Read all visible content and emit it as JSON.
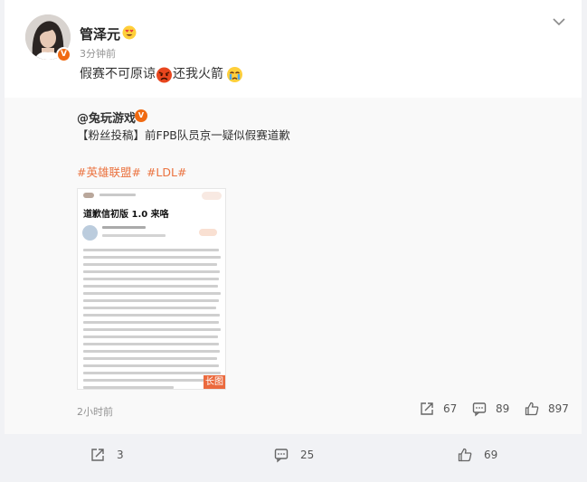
{
  "post": {
    "username": "管泽元",
    "time": "3分钟前",
    "text_part1": "假赛不可原谅",
    "text_part2": "还我火箭",
    "name_emoji": "heart-eyes-emoji",
    "emoji1": "angry-emoji",
    "emoji2": "crying-emoji",
    "avatar_badge": "V"
  },
  "repost": {
    "author": "@兔玩游戏",
    "badge": "V",
    "text": "【粉丝投稿】前FPB队员京一疑似假赛道歉",
    "tags": [
      "#英雄联盟#",
      "#LDL#"
    ],
    "long_image": {
      "title": "道歉信初版 1.0 来咯",
      "badge": "长图"
    },
    "time": "2小时前",
    "actions": {
      "repost_count": "67",
      "comment_count": "89",
      "like_count": "897"
    }
  },
  "footer": {
    "repost_count": "3",
    "comment_count": "25",
    "like_count": "69"
  },
  "colors": {
    "accent": "#eb7340",
    "badge": "#f06a12",
    "background": "#f1f2f5",
    "repost_bg": "#f9f9f9"
  }
}
